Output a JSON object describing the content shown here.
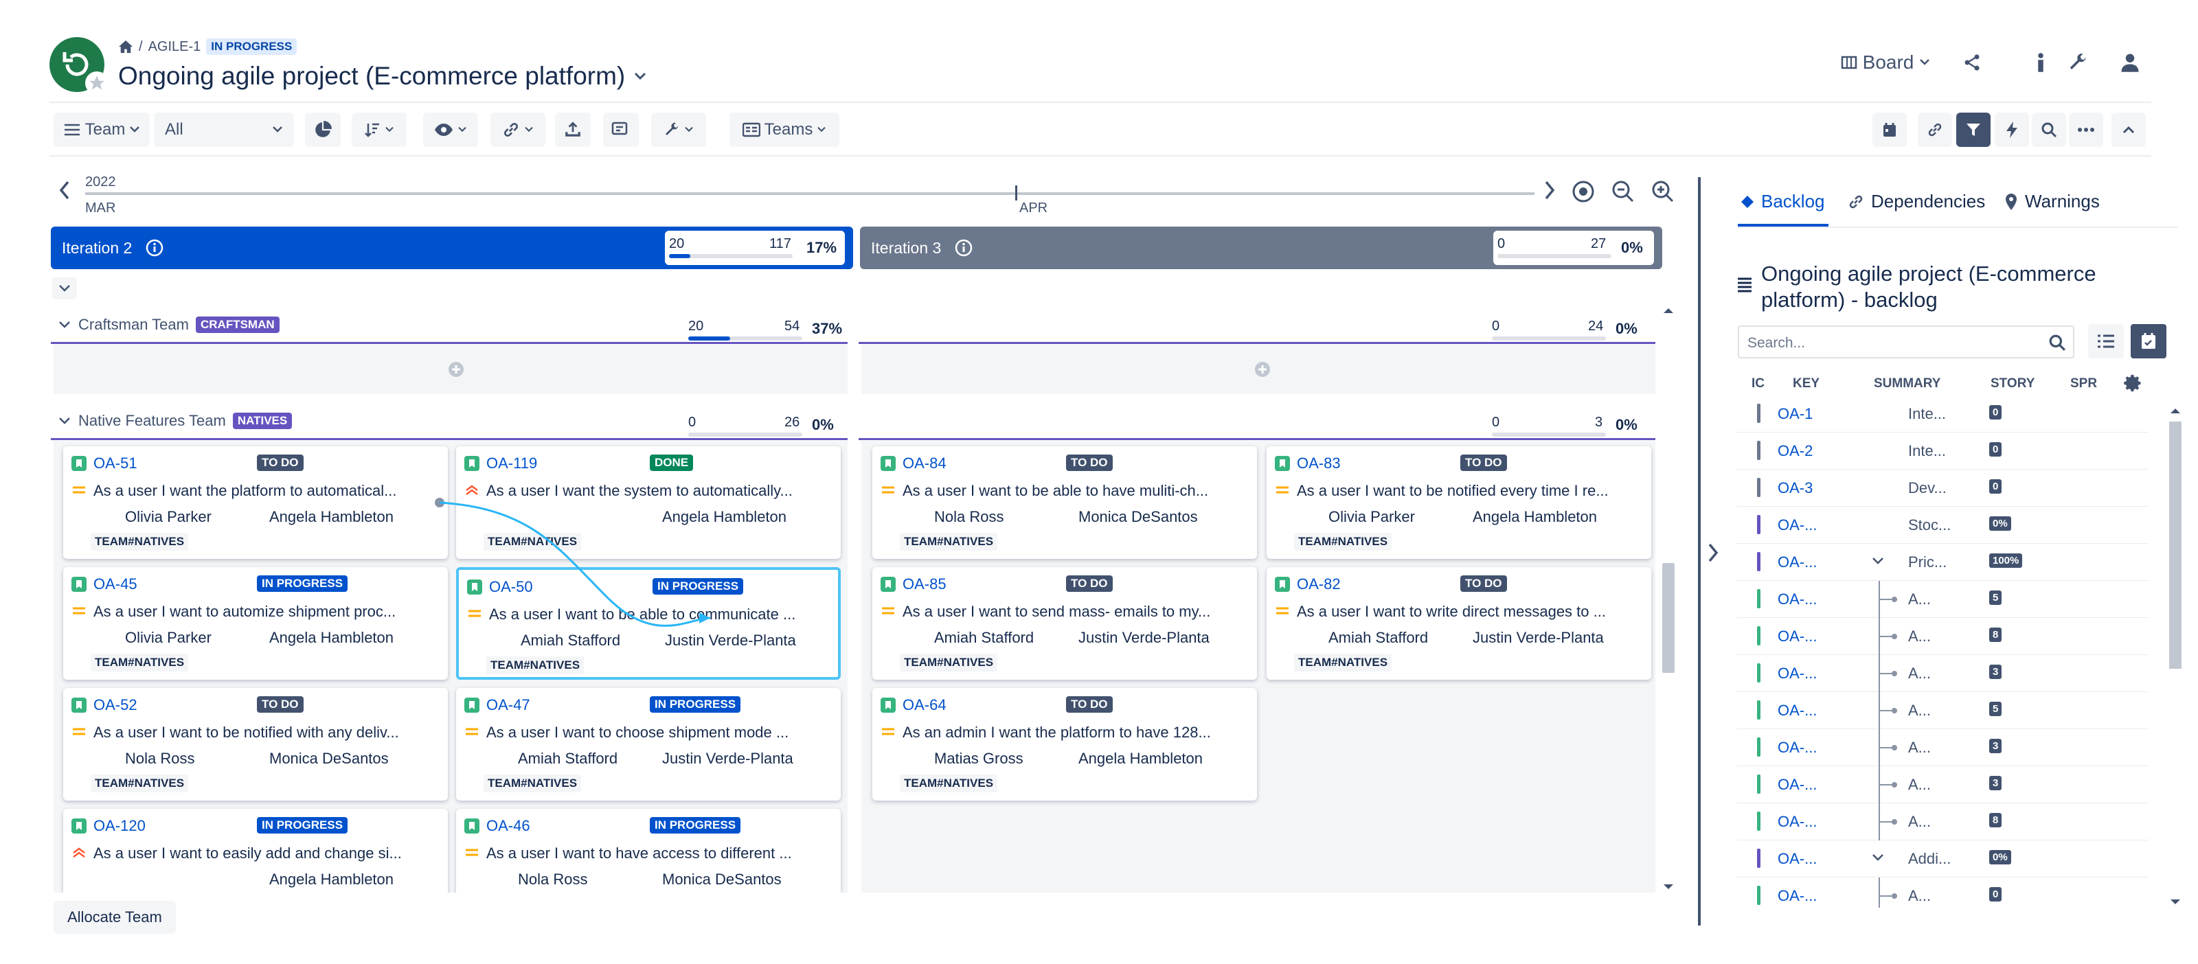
{
  "header": {
    "breadcrumb_key": "AGILE-1",
    "status": "IN PROGRESS",
    "title": "Ongoing agile project (E-commerce platform)",
    "board_label": "Board"
  },
  "toolbar": {
    "team_label": "Team",
    "filter_value": "All",
    "teams_label": "Teams"
  },
  "timeline": {
    "year": "2022",
    "month_left": "MAR",
    "month_mid": "APR"
  },
  "iterations": [
    {
      "name": "Iteration 2",
      "min": "20",
      "max": "117",
      "pct": "17%",
      "fill": 0.17,
      "color": "#0052cc"
    },
    {
      "name": "Iteration 3",
      "min": "0",
      "max": "27",
      "pct": "0%",
      "fill": 0.0,
      "color": "#6b778c"
    }
  ],
  "teams": [
    {
      "name": "Craftsman Team",
      "tag": "CRAFTSMAN",
      "it2": {
        "min": "20",
        "max": "54",
        "pct": "37%",
        "fill": 0.37
      },
      "it3": {
        "min": "0",
        "max": "24",
        "pct": "0%",
        "fill": 0.0
      }
    },
    {
      "name": "Native Features Team",
      "tag": "NATIVES",
      "it2": {
        "min": "0",
        "max": "26",
        "pct": "0%",
        "fill": 0.0
      },
      "it3": {
        "min": "0",
        "max": "3",
        "pct": "0%",
        "fill": 0.0
      }
    }
  ],
  "cards": [
    {
      "key": "OA-51",
      "status": "TO DO",
      "summary": "As a user I want the platform to automatical...",
      "a1": "Olivia Parker",
      "a2": "Angela Hambleton",
      "tag": "TEAM#NATIVES",
      "priority": "medium"
    },
    {
      "key": "OA-119",
      "status": "DONE",
      "summary": "As a user I want the system to automatically...",
      "a1": "",
      "a2": "Angela Hambleton",
      "tag": "TEAM#NATIVES",
      "priority": "high"
    },
    {
      "key": "OA-84",
      "status": "TO DO",
      "summary": "As a user I want to be able to have muliti-ch...",
      "a1": "Nola Ross",
      "a2": "Monica DeSantos",
      "tag": "TEAM#NATIVES",
      "priority": "medium"
    },
    {
      "key": "OA-83",
      "status": "TO DO",
      "summary": "As a user I want to be notified every time I re...",
      "a1": "Olivia Parker",
      "a2": "Angela Hambleton",
      "tag": "TEAM#NATIVES",
      "priority": "medium"
    },
    {
      "key": "OA-45",
      "status": "IN PROGRESS",
      "summary": "As a user I want to automize shipment proc...",
      "a1": "Olivia Parker",
      "a2": "Angela Hambleton",
      "tag": "TEAM#NATIVES",
      "priority": "medium"
    },
    {
      "key": "OA-50",
      "status": "IN PROGRESS",
      "summary": "As a user I want to be able to communicate ...",
      "a1": "Amiah Stafford",
      "a2": "Justin Verde-Planta",
      "tag": "TEAM#NATIVES",
      "priority": "medium"
    },
    {
      "key": "OA-85",
      "status": "TO DO",
      "summary": "As a user I want to send mass- emails to my...",
      "a1": "Amiah Stafford",
      "a2": "Justin Verde-Planta",
      "tag": "TEAM#NATIVES",
      "priority": "medium"
    },
    {
      "key": "OA-82",
      "status": "TO DO",
      "summary": "As a user I want to write direct messages to ...",
      "a1": "Amiah Stafford",
      "a2": "Justin Verde-Planta",
      "tag": "TEAM#NATIVES",
      "priority": "medium"
    },
    {
      "key": "OA-52",
      "status": "TO DO",
      "summary": "As a user I want to be notified with any deliv...",
      "a1": "Nola Ross",
      "a2": "Monica DeSantos",
      "tag": "TEAM#NATIVES",
      "priority": "medium"
    },
    {
      "key": "OA-47",
      "status": "IN PROGRESS",
      "summary": "As a user I want to choose shipment mode ...",
      "a1": "Amiah Stafford",
      "a2": "Justin Verde-Planta",
      "tag": "TEAM#NATIVES",
      "priority": "medium"
    },
    {
      "key": "OA-64",
      "status": "TO DO",
      "summary": "As an admin I want the platform to have 128...",
      "a1": "Matias Gross",
      "a2": "Angela Hambleton",
      "tag": "TEAM#NATIVES",
      "priority": "medium"
    },
    {
      "key": "OA-120",
      "status": "IN PROGRESS",
      "summary": "As a user I want to easily add and change si...",
      "a1": "",
      "a2": "Angela Hambleton",
      "tag": "",
      "priority": "high"
    },
    {
      "key": "OA-46",
      "status": "IN PROGRESS",
      "summary": "As a user I want to have access to different ...",
      "a1": "Nola Ross",
      "a2": "Monica DeSantos",
      "tag": "",
      "priority": "medium"
    }
  ],
  "footer": {
    "allocate_label": "Allocate Team"
  },
  "right_panel": {
    "tabs": [
      "Backlog",
      "Dependencies",
      "Warnings"
    ],
    "title": "Ongoing agile project (E-commerce platform) - backlog",
    "search_placeholder": "Search...",
    "columns": [
      "IC",
      "KEY",
      "SUMMARY",
      "STORY",
      "SPR"
    ],
    "rows": [
      {
        "key": "OA-1",
        "summary": "Inte...",
        "points": "0",
        "color": "#6b778c",
        "indent": false,
        "expand": false
      },
      {
        "key": "OA-2",
        "summary": "Inte...",
        "points": "0",
        "color": "#6b778c",
        "indent": false,
        "expand": false
      },
      {
        "key": "OA-3",
        "summary": "Dev...",
        "points": "0",
        "color": "#6b778c",
        "indent": false,
        "expand": false
      },
      {
        "key": "OA-...",
        "summary": "Stoc...",
        "points": "0%",
        "color": "#6554c0",
        "indent": false,
        "expand": false
      },
      {
        "key": "OA-...",
        "summary": "Pric...",
        "points": "100%",
        "color": "#6554c0",
        "indent": false,
        "expand": true
      },
      {
        "key": "OA-...",
        "summary": "A...",
        "points": "5",
        "color": "#36b37e",
        "indent": true,
        "expand": false
      },
      {
        "key": "OA-...",
        "summary": "A...",
        "points": "8",
        "color": "#36b37e",
        "indent": true,
        "expand": false
      },
      {
        "key": "OA-...",
        "summary": "A...",
        "points": "3",
        "color": "#36b37e",
        "indent": true,
        "expand": false
      },
      {
        "key": "OA-...",
        "summary": "A...",
        "points": "5",
        "color": "#36b37e",
        "indent": true,
        "expand": false
      },
      {
        "key": "OA-...",
        "summary": "A...",
        "points": "3",
        "color": "#36b37e",
        "indent": true,
        "expand": false
      },
      {
        "key": "OA-...",
        "summary": "A...",
        "points": "3",
        "color": "#36b37e",
        "indent": true,
        "expand": false
      },
      {
        "key": "OA-...",
        "summary": "A...",
        "points": "8",
        "color": "#36b37e",
        "indent": true,
        "expand": false
      },
      {
        "key": "OA-...",
        "summary": "Addi...",
        "points": "0%",
        "color": "#6554c0",
        "indent": false,
        "expand": true
      },
      {
        "key": "OA-...",
        "summary": "A...",
        "points": "0",
        "color": "#36b37e",
        "indent": true,
        "expand": false
      }
    ]
  }
}
